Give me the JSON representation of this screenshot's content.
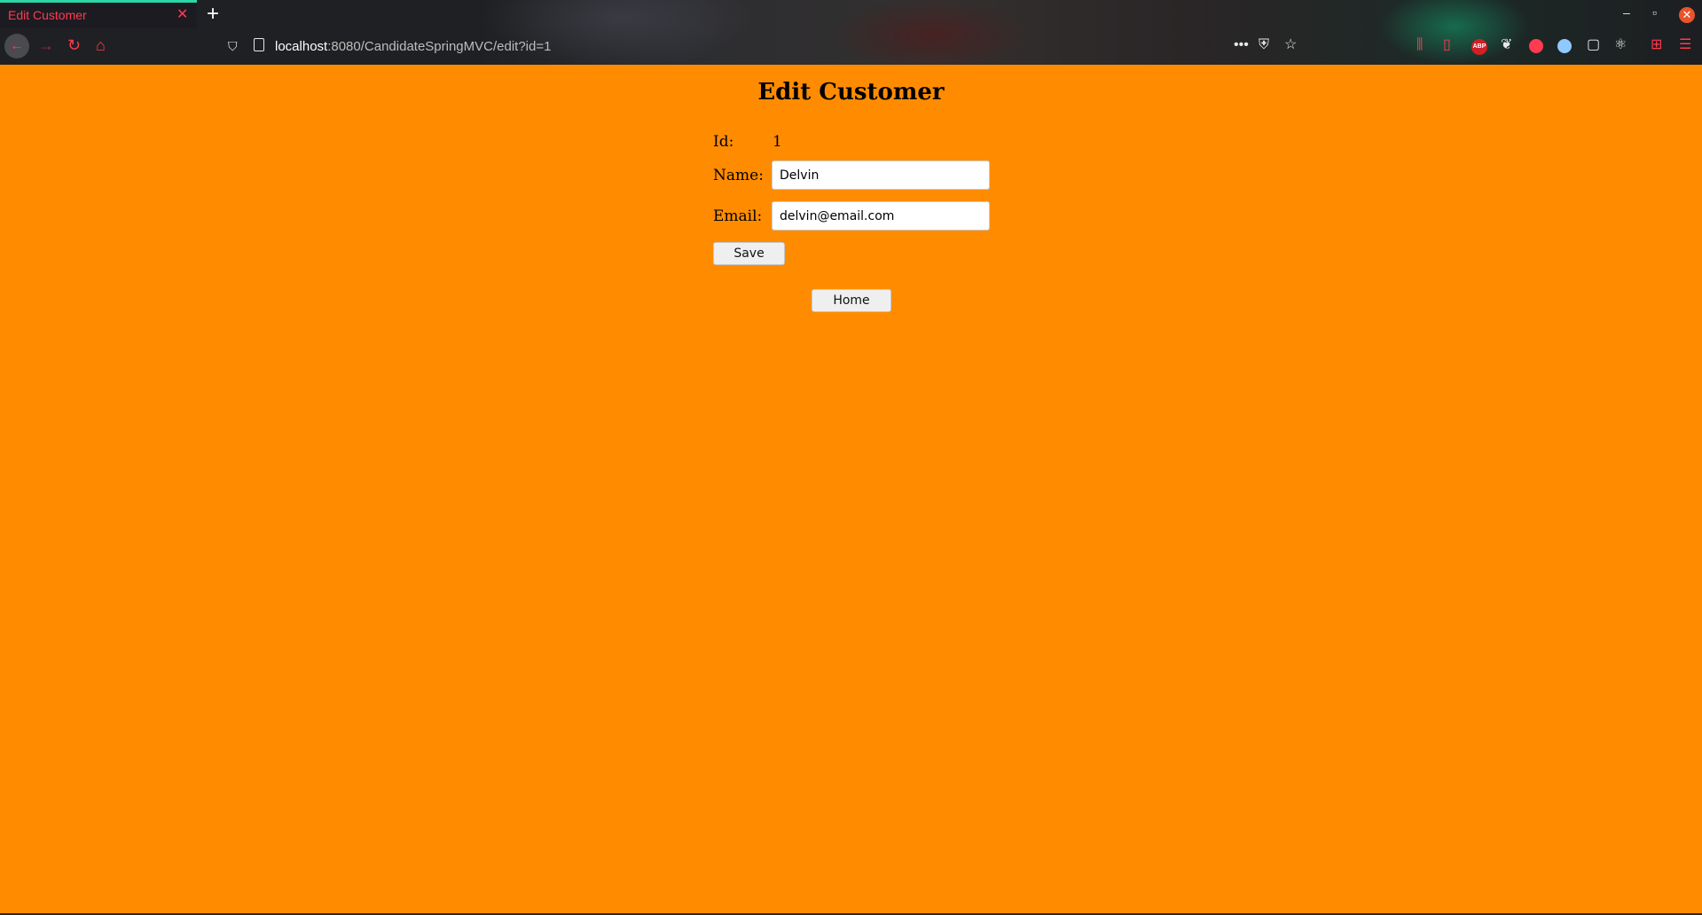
{
  "browser": {
    "tab_title": "Edit Customer",
    "tab_close": "✕",
    "new_tab": "+",
    "url_host": "localhost",
    "url_rest": ":8080/CandidateSpringMVC/edit?id=1",
    "window_controls": {
      "minimize": "–",
      "restore": "▫",
      "close": "✕"
    },
    "accent_color": "#ff3b4f"
  },
  "page": {
    "background": "#ff8c00",
    "title": "Edit Customer",
    "form": {
      "id_label": "Id:",
      "id_value": "1",
      "name_label": "Name:",
      "name_value": "Delvin",
      "email_label": "Email:",
      "email_value": "delvin@email.com",
      "save_label": "Save"
    },
    "home_label": "Home"
  }
}
